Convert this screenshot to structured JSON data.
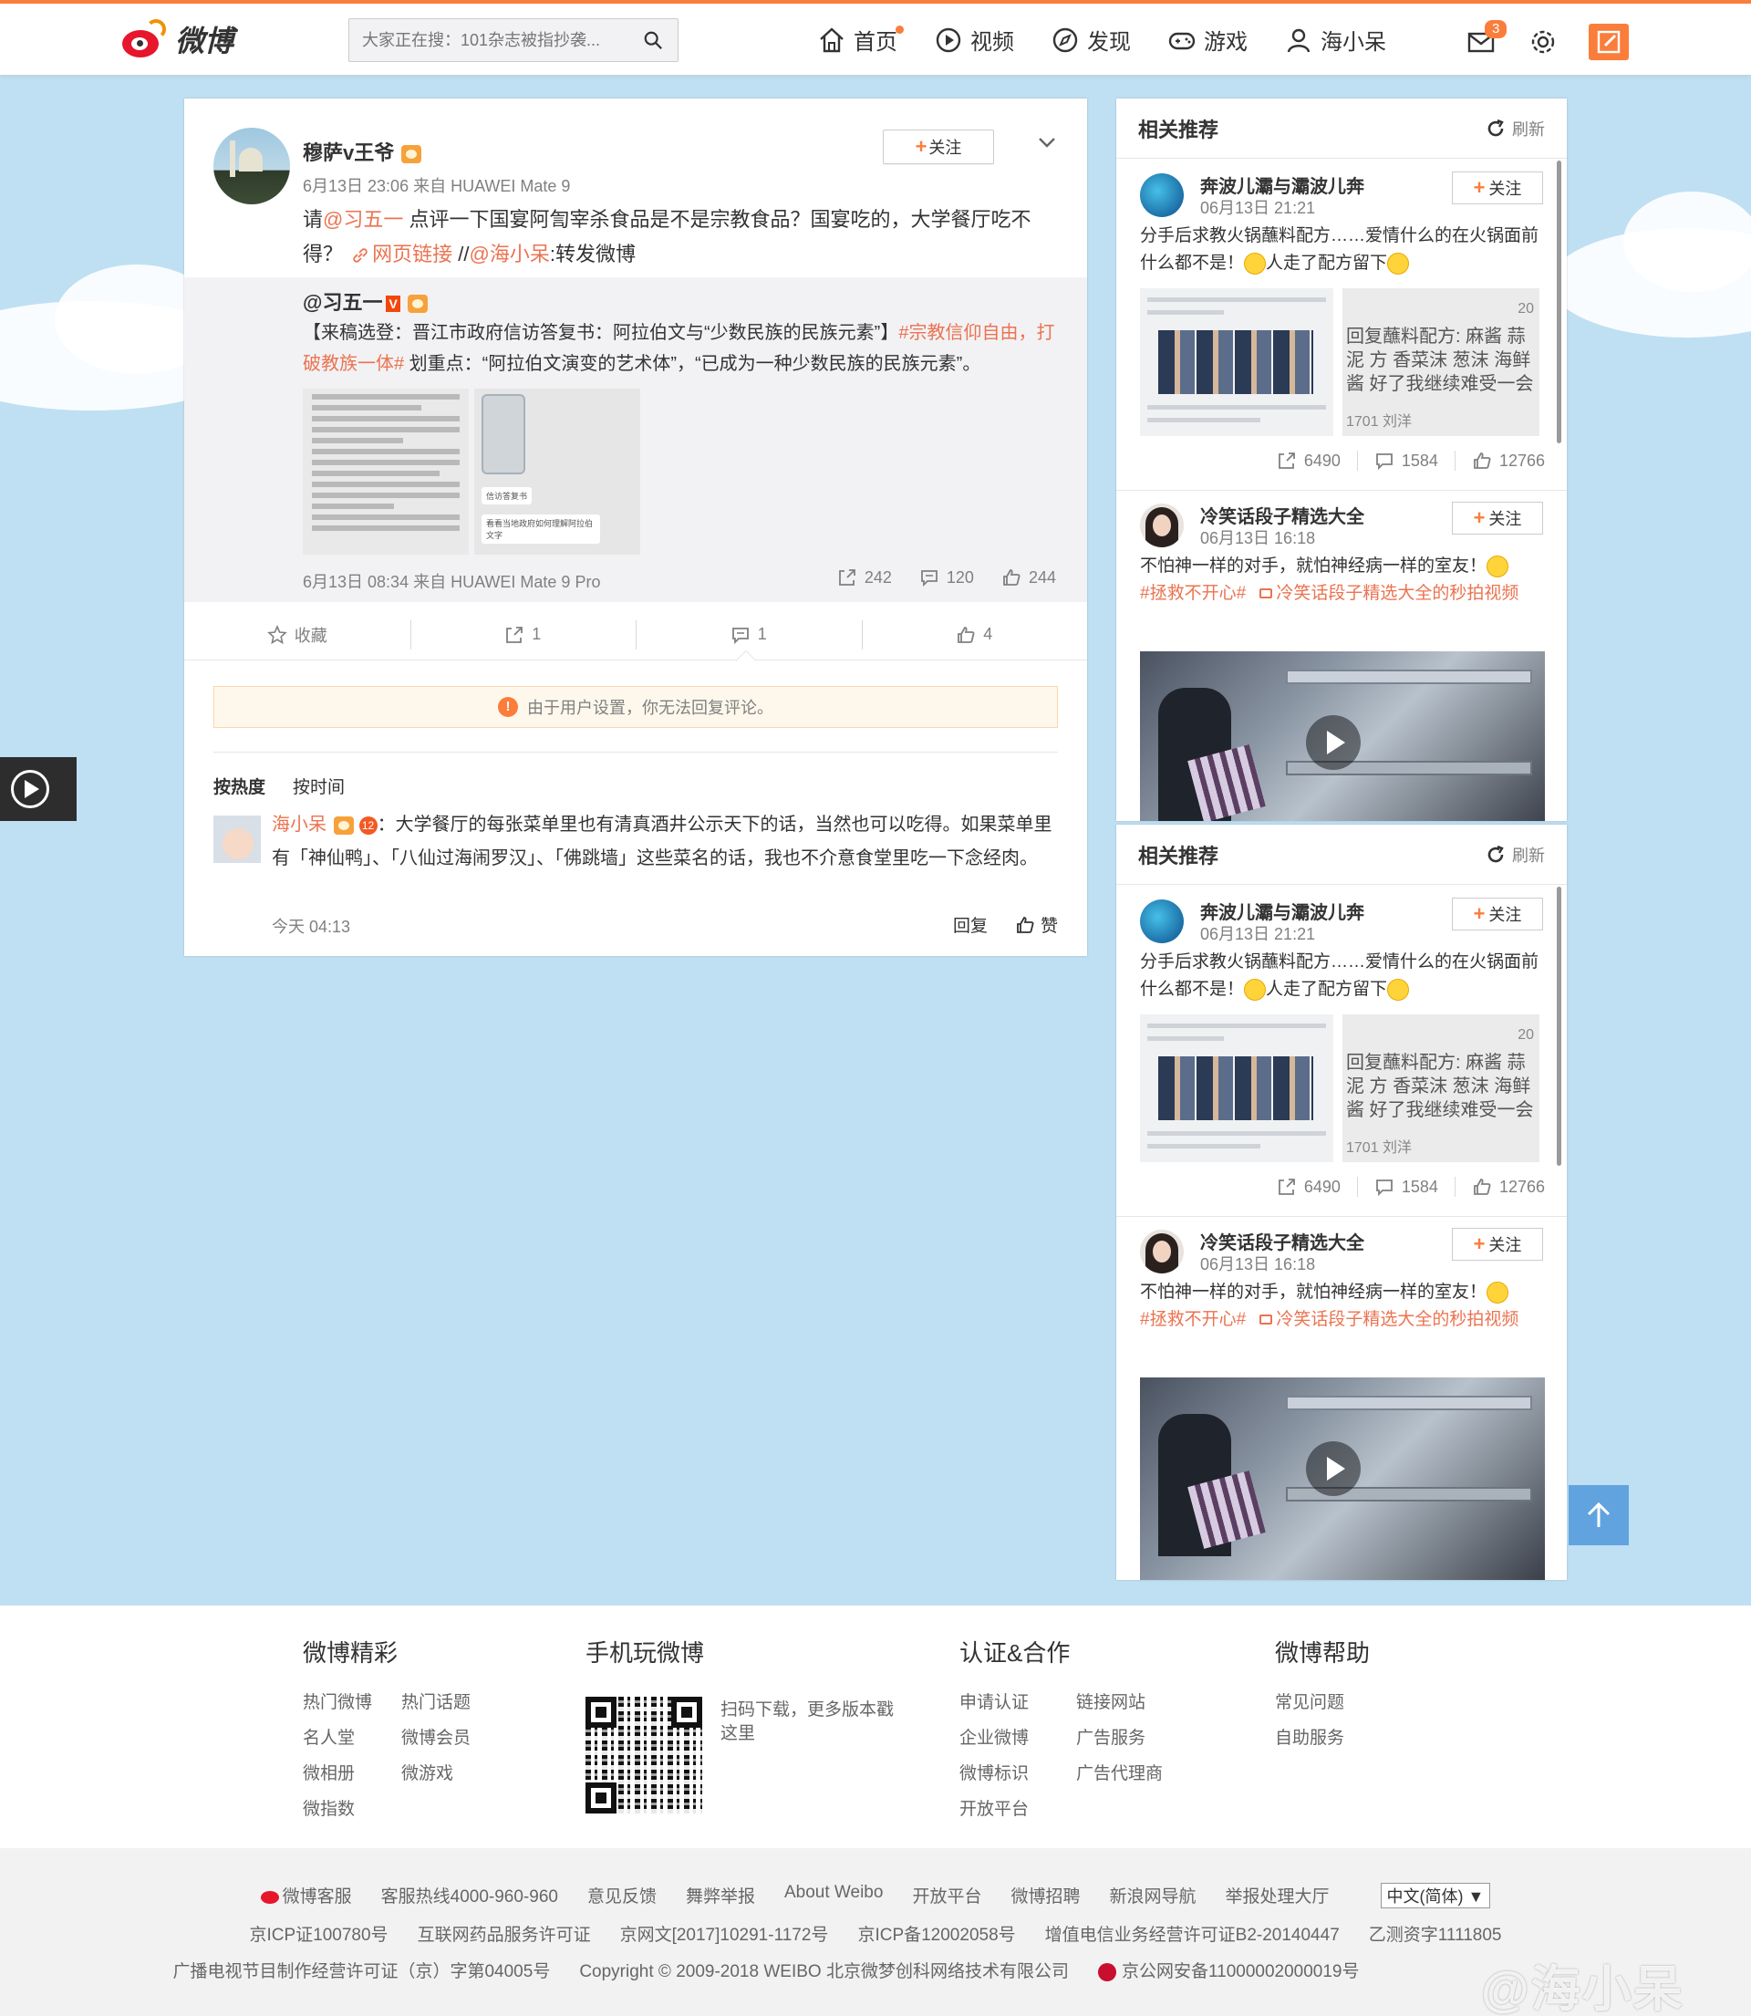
{
  "header": {
    "logo_text": "微博",
    "search_placeholder": "大家正在搜：101杂志被指抄袭...",
    "nav": [
      {
        "label": "首页",
        "icon": "home-icon"
      },
      {
        "label": "视频",
        "icon": "video-icon"
      },
      {
        "label": "发现",
        "icon": "compass-icon"
      },
      {
        "label": "游戏",
        "icon": "gamepad-icon"
      },
      {
        "label": "海小呆",
        "icon": "user-icon"
      }
    ],
    "message_badge": "3",
    "accent": "#fa7d3c"
  },
  "post": {
    "username": "穆萨v王爷",
    "meta": "6月13日 23:06 来自 HUAWEI Mate 9",
    "follow_label": "关注",
    "text_prefix": "请",
    "mention1": "@习五一",
    "text_mid": " 点评一下国宴阿訇宰杀食品是不是宗教食品？国宴吃的，大学餐厅吃不得？ ",
    "link_text": "网页链接",
    "text_sep": " //",
    "mention2": "@海小呆",
    "text_tail": ":转发微博",
    "repost": {
      "username": "@习五一",
      "text_a": "【来稿选登：晋江市政府信访答复书：阿拉伯文与“少数民族的民族元素”】",
      "topic": "#宗教信仰自由，打破教族一体#",
      "text_b": " 划重点：“阿拉伯文演变的艺术体”，“已成为一种少数民族的民族元素”。",
      "thumb2_caption1": "信访答复书",
      "thumb2_caption2": "看看当地政府如何理解阿拉伯文字",
      "meta": "6月13日 08:34 来自 HUAWEI Mate 9 Pro",
      "reposts": "242",
      "comments": "120",
      "likes": "244"
    },
    "actions": {
      "favorite": "收藏",
      "repost": "1",
      "comment": "1",
      "like": "4"
    },
    "notice": "由于用户设置，你无法回复评论。",
    "sort_hot": "按热度",
    "sort_time": "按时间",
    "comment": {
      "user": "海小呆",
      "text": "：大学餐厅的每张菜单里也有清真酒井公示天下的话，当然也可以吃得。如果菜单里有「神仙鸭」、「八仙过海闹罗汉」、「佛跳墙」这些菜名的话，我也不介意食堂里吃一下念经肉。",
      "time": "今天 04:13",
      "reply": "回复",
      "like": "赞"
    }
  },
  "side": {
    "title": "相关推荐",
    "refresh": "刷新",
    "follow": "关注",
    "item1": {
      "name": "奔波儿灞与灞波儿奔",
      "time": "06月13日 21:21",
      "text": "分手后求教火锅蘸料配方……爱情什么的在火锅面前什么都不是！",
      "text2": "人走了配方留下",
      "pic_top": "20",
      "pic_text": "回复蘸料配方: 麻酱 蒜泥 方 香菜沫 葱沫 海鲜酱 好了我继续难受一会",
      "pic_bottom": "1701 刘洋",
      "pic_bottom_r": "20",
      "reposts": "6490",
      "comments": "1584",
      "likes": "12766"
    },
    "item2": {
      "name": "冷笑话段子精选大全",
      "time": "06月13日 16:18",
      "text": "不怕神一样的对手，就怕神经病一样的室友！",
      "topic": "#拯救不开心#",
      "video_link": "冷笑话段子精选大全的秒拍视频"
    }
  },
  "footer": {
    "col1": {
      "title": "微博精彩",
      "links": [
        "热门微博",
        "热门话题",
        "名人堂",
        "微博会员",
        "微相册",
        "微游戏",
        "微指数"
      ]
    },
    "col2": {
      "title": "手机玩微博",
      "desc": "扫码下载，更多版本戳这里"
    },
    "col3": {
      "title": "认证&合作",
      "links": [
        "申请认证",
        "链接网站",
        "企业微博",
        "广告服务",
        "微博标识",
        "广告代理商",
        "开放平台"
      ]
    },
    "col4": {
      "title": "微博帮助",
      "links": [
        "常见问题",
        "自助服务"
      ]
    },
    "row1": [
      "微博客服",
      "客服热线4000-960-960",
      "意见反馈",
      "舞弊举报",
      "About Weibo",
      "开放平台",
      "微博招聘",
      "新浪网导航",
      "举报处理大厅"
    ],
    "lang": "中文(简体)",
    "row2": [
      "京ICP证100780号",
      "互联网药品服务许可证",
      "京网文[2017]10291-1172号",
      "京ICP备12002058号",
      "增值电信业务经营许可证B2-20140447",
      "乙测资字1111805"
    ],
    "row3": [
      "广播电视节目制作经营许可证（京）字第04005号",
      "Copyright © 2009-2018 WEIBO 北京微梦创科网络技术有限公司",
      "京公网安备11000002000019号"
    ],
    "watermark": "@海小呆"
  }
}
